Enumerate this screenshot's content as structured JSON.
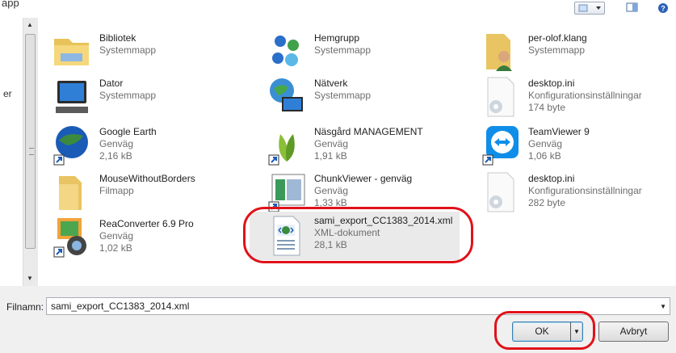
{
  "breadcrumb": "app",
  "left_nav_fragment": "er",
  "items": [
    {
      "name": "Bibliotek",
      "sub": [
        "Systemmapp"
      ],
      "icon": "library-icon"
    },
    {
      "name": "Hemgrupp",
      "sub": [
        "Systemmapp"
      ],
      "icon": "homegroup-icon"
    },
    {
      "name": "per-olof.klang",
      "sub": [
        "Systemmapp"
      ],
      "icon": "user-folder-icon"
    },
    {
      "name": "Dator",
      "sub": [
        "Systemmapp"
      ],
      "icon": "computer-icon"
    },
    {
      "name": "Nätverk",
      "sub": [
        "Systemmapp"
      ],
      "icon": "network-icon"
    },
    {
      "name": "desktop.ini",
      "sub": [
        "Konfigurationsinställningar",
        "174 byte"
      ],
      "icon": "config-file-icon"
    },
    {
      "name": "Google Earth",
      "sub": [
        "Genväg",
        "2,16 kB"
      ],
      "icon": "google-earth-icon"
    },
    {
      "name": "Näsgård MANAGEMENT",
      "sub": [
        "Genväg",
        "1,91 kB"
      ],
      "icon": "nasgard-icon"
    },
    {
      "name": "TeamViewer 9",
      "sub": [
        "Genväg",
        "1,06 kB"
      ],
      "icon": "teamviewer-icon"
    },
    {
      "name": "MouseWithoutBorders",
      "sub": [
        "Filmapp"
      ],
      "icon": "folder-icon"
    },
    {
      "name": "ChunkViewer - genväg",
      "sub": [
        "Genväg",
        "1,33 kB"
      ],
      "icon": "chunkviewer-icon"
    },
    {
      "name": "desktop.ini",
      "sub": [
        "Konfigurationsinställningar",
        "282 byte"
      ],
      "icon": "config-file-icon"
    },
    {
      "name": "ReaConverter 6.9 Pro",
      "sub": [
        "Genväg",
        "1,02 kB"
      ],
      "icon": "reaconverter-icon"
    },
    {
      "name": "sami_export_CC1383_2014.xml",
      "sub": [
        "XML-dokument",
        "28,1 kB"
      ],
      "icon": "xml-file-icon"
    }
  ],
  "filename": {
    "label": "Filnamn:",
    "value": "sami_export_CC1383_2014.xml"
  },
  "buttons": {
    "ok": "OK",
    "cancel": "Avbryt"
  },
  "colors": {
    "annotation": "#e0121a",
    "selected_bg": "#eaeaea"
  }
}
